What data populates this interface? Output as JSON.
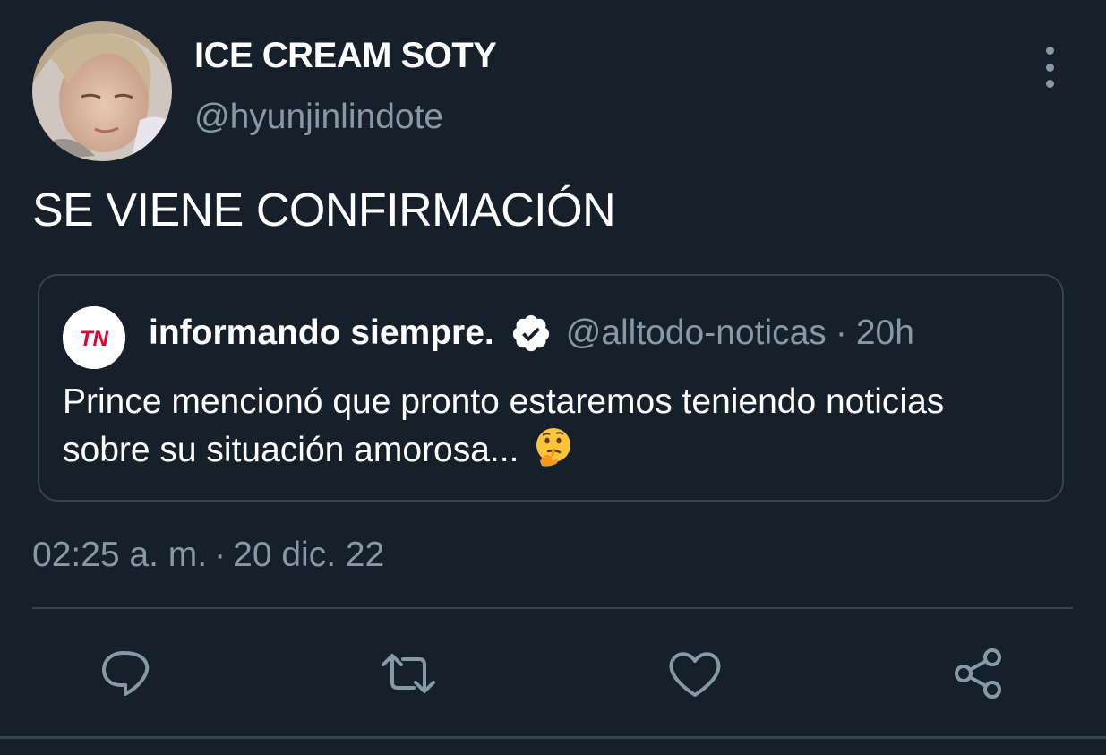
{
  "author": {
    "display_name": "ICE CREAM SOTY",
    "handle": "@hyunjinlindote"
  },
  "tweet": {
    "text": "SE VIENE CONFIRMACIÓN"
  },
  "quoted_tweet": {
    "avatar_logo_text": "TN",
    "display_name": "informando siempre.",
    "handle": "@alltodo-noticas",
    "separator": "·",
    "time": "20h",
    "text": "Prince mencionó que pronto estaremos teniendo noticias sobre su situación amorosa..."
  },
  "meta": {
    "time": "02:25 a. m.",
    "separator": "·",
    "date": "20 dic. 22"
  },
  "icons": {
    "more": "vertical-ellipsis-icon",
    "verified": "verified-badge-icon",
    "emoji": "thinking-face-icon",
    "reply": "reply-icon",
    "retweet": "retweet-icon",
    "like": "heart-icon",
    "share": "share-icon"
  },
  "colors": {
    "background": "#15202b",
    "secondary_text": "#8899a6",
    "border": "#38444d",
    "brand_red": "#e4002b",
    "brand_blue": "#1e3c8c"
  }
}
